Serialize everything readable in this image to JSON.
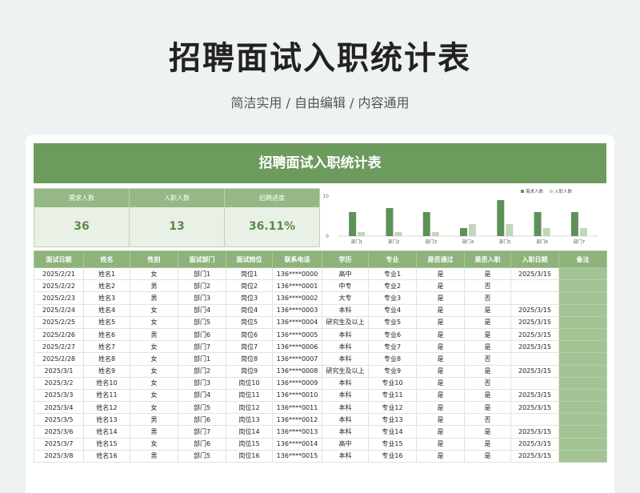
{
  "page": {
    "title": "招聘面试入职统计表",
    "subtitle": "简洁实用 / 自由编辑 / 内容通用"
  },
  "sheet": {
    "banner": "招聘面试入职统计表",
    "kpis": [
      {
        "label": "需求人数",
        "value": "36"
      },
      {
        "label": "入职人数",
        "value": "13"
      },
      {
        "label": "招聘进度",
        "value": "36.11%"
      }
    ]
  },
  "chart_data": {
    "type": "bar",
    "categories": [
      "部门1",
      "部门2",
      "部门3",
      "部门4",
      "部门5",
      "部门6",
      "部门7"
    ],
    "series": [
      {
        "name": "需求人数",
        "values": [
          6,
          7,
          6,
          2,
          9,
          6,
          6
        ],
        "color": "#5c9159"
      },
      {
        "name": "入职人数",
        "values": [
          1,
          1,
          1,
          3,
          3,
          2,
          2
        ],
        "color": "#c3d6ba"
      }
    ],
    "ylim": [
      0,
      10
    ],
    "yticks": [
      "0",
      "10"
    ],
    "legend": "top-right",
    "grid": false
  },
  "table": {
    "headers": [
      "面试日期",
      "姓名",
      "性别",
      "面试部门",
      "面试岗位",
      "联系电话",
      "学历",
      "专业",
      "是否通过",
      "是否入职",
      "入职日期",
      "备注"
    ],
    "rows": [
      [
        "2025/2/21",
        "姓名1",
        "女",
        "部门1",
        "岗位1",
        "136****0000",
        "高中",
        "专业1",
        "是",
        "是",
        "2025/3/15",
        ""
      ],
      [
        "2025/2/22",
        "姓名2",
        "男",
        "部门2",
        "岗位2",
        "136****0001",
        "中专",
        "专业2",
        "是",
        "否",
        "",
        ""
      ],
      [
        "2025/2/23",
        "姓名3",
        "男",
        "部门3",
        "岗位3",
        "136****0002",
        "大专",
        "专业3",
        "是",
        "否",
        "",
        ""
      ],
      [
        "2025/2/24",
        "姓名4",
        "女",
        "部门4",
        "岗位4",
        "136****0003",
        "本科",
        "专业4",
        "是",
        "是",
        "2025/3/15",
        ""
      ],
      [
        "2025/2/25",
        "姓名5",
        "女",
        "部门5",
        "岗位5",
        "136****0004",
        "研究生及以上",
        "专业5",
        "是",
        "是",
        "2025/3/15",
        ""
      ],
      [
        "2025/2/26",
        "姓名6",
        "男",
        "部门6",
        "岗位6",
        "136****0005",
        "本科",
        "专业6",
        "是",
        "是",
        "2025/3/15",
        ""
      ],
      [
        "2025/2/27",
        "姓名7",
        "女",
        "部门7",
        "岗位7",
        "136****0006",
        "本科",
        "专业7",
        "是",
        "是",
        "2025/3/15",
        ""
      ],
      [
        "2025/2/28",
        "姓名8",
        "女",
        "部门1",
        "岗位8",
        "136****0007",
        "本科",
        "专业8",
        "是",
        "否",
        "",
        ""
      ],
      [
        "2025/3/1",
        "姓名9",
        "女",
        "部门2",
        "岗位9",
        "136****0008",
        "研究生及以上",
        "专业9",
        "是",
        "是",
        "2025/3/15",
        ""
      ],
      [
        "2025/3/2",
        "姓名10",
        "女",
        "部门3",
        "岗位10",
        "136****0009",
        "本科",
        "专业10",
        "是",
        "否",
        "",
        ""
      ],
      [
        "2025/3/3",
        "姓名11",
        "女",
        "部门4",
        "岗位11",
        "136****0010",
        "本科",
        "专业11",
        "是",
        "是",
        "2025/3/15",
        ""
      ],
      [
        "2025/3/4",
        "姓名12",
        "女",
        "部门5",
        "岗位12",
        "136****0011",
        "本科",
        "专业12",
        "是",
        "是",
        "2025/3/15",
        ""
      ],
      [
        "2025/3/5",
        "姓名13",
        "男",
        "部门6",
        "岗位13",
        "136****0012",
        "本科",
        "专业13",
        "是",
        "否",
        "",
        ""
      ],
      [
        "2025/3/6",
        "姓名14",
        "男",
        "部门7",
        "岗位14",
        "136****0013",
        "本科",
        "专业14",
        "是",
        "是",
        "2025/3/15",
        ""
      ],
      [
        "2025/3/7",
        "姓名15",
        "女",
        "部门6",
        "岗位15",
        "136****0014",
        "高中",
        "专业15",
        "是",
        "是",
        "2025/3/15",
        ""
      ],
      [
        "2025/3/8",
        "姓名16",
        "男",
        "部门5",
        "岗位16",
        "136****0015",
        "本科",
        "专业16",
        "是",
        "是",
        "2025/3/15",
        ""
      ]
    ]
  }
}
